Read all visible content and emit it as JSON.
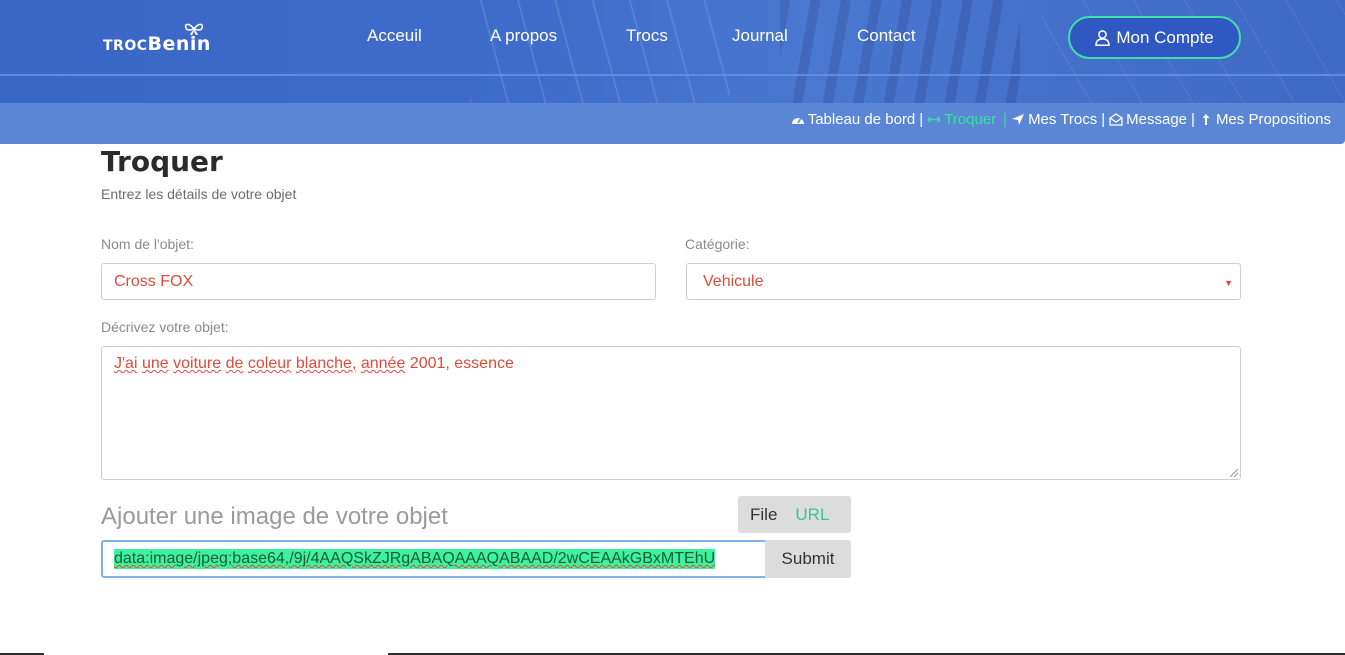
{
  "brand": {
    "logo_text_small": "TROC",
    "logo_text_big": "Benin"
  },
  "nav": {
    "items": [
      {
        "label": "Acceuil"
      },
      {
        "label": "A propos"
      },
      {
        "label": "Trocs"
      },
      {
        "label": "Journal"
      },
      {
        "label": "Contact"
      }
    ],
    "account_button": "Mon Compte"
  },
  "subnav": {
    "items": [
      {
        "label": "Tableau de bord",
        "icon": "dashboard-icon"
      },
      {
        "label": "Troquer",
        "icon": "exchange-icon",
        "active": true
      },
      {
        "label": "Mes Trocs",
        "icon": "location-arrow-icon"
      },
      {
        "label": "Message",
        "icon": "envelope-open-icon"
      },
      {
        "label": "Mes Propositions",
        "icon": "arrow-up-icon"
      }
    ],
    "separator": "|"
  },
  "page": {
    "title": "Troquer",
    "subtitle": "Entrez les détails de votre objet"
  },
  "form": {
    "name_label": "Nom de l'objet:",
    "name_value": "Cross FOX",
    "category_label": "Catégorie:",
    "category_value": "Vehicule",
    "description_label": "Décrivez votre objet:",
    "description_words": [
      "J'ai",
      "une",
      "voiture",
      "de",
      "coleur",
      "blanche,",
      "année",
      "2001, essence"
    ],
    "image_title": "Ajouter une image de votre objet",
    "tab_file": "File",
    "tab_url": "URL",
    "url_value": "data:image/jpeg;base64,/9j/4AAQSkZJRgABAQAAAQABAAD/2wCEAAkGBxMTEhU",
    "submit_label": "Submit"
  },
  "colors": {
    "header": "#3f6cca",
    "subbar": "#5b86d6",
    "accent_green": "#33e39b",
    "input_text": "#e04a3a"
  }
}
